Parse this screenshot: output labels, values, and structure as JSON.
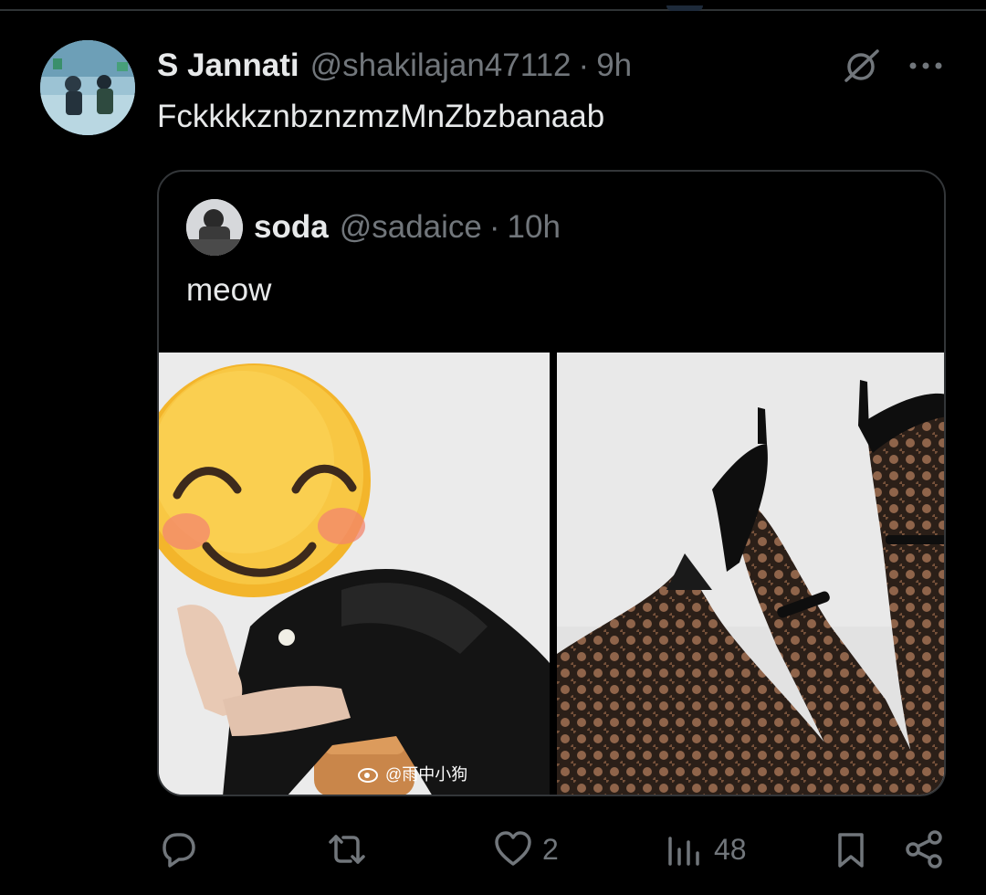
{
  "tweet": {
    "author_name": "S Jannati",
    "author_handle": "@shakilajan47112",
    "separator": "·",
    "time": "9h",
    "text": "FckkkkznbznzmzMnZbzbanaab",
    "icons": {
      "grok": "grok-icon",
      "more": "more-icon"
    }
  },
  "quote": {
    "author_name": "soda",
    "author_handle": "@sadaice",
    "separator": "·",
    "time": "10h",
    "text": "meow",
    "media": [
      {
        "description": "person in black sweater with emoji over face",
        "watermark": "@雨中小狗"
      },
      {
        "description": "legs in lace stockings and black heels"
      }
    ]
  },
  "actions": {
    "reply": {
      "icon": "reply-icon",
      "count": ""
    },
    "repost": {
      "icon": "repost-icon",
      "count": ""
    },
    "like": {
      "icon": "heart-icon",
      "count": "2"
    },
    "views": {
      "icon": "views-icon",
      "count": "48"
    },
    "bookmark": {
      "icon": "bookmark-icon"
    },
    "share": {
      "icon": "share-icon"
    }
  },
  "colors": {
    "background": "#000000",
    "text_primary": "#e7e9ea",
    "text_secondary": "#71767b",
    "border": "#333639"
  }
}
